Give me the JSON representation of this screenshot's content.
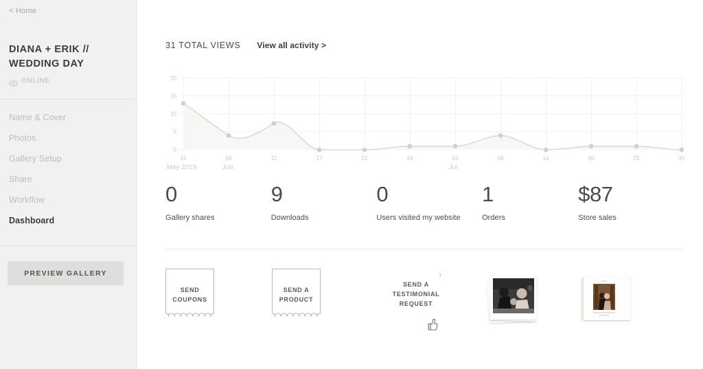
{
  "sidebar": {
    "home_link": "< Home",
    "gallery_title": "DIANA + ERIK // WEDDING DAY",
    "status": "ONLINE",
    "status_icon": "eye-icon",
    "nav_items": [
      {
        "label": "Name & Cover",
        "active": false
      },
      {
        "label": "Photos",
        "active": false
      },
      {
        "label": "Gallery Setup",
        "active": false
      },
      {
        "label": "Share",
        "active": false
      },
      {
        "label": "Workflow",
        "active": false
      },
      {
        "label": "Dashboard",
        "active": true
      }
    ],
    "preview_button": "PREVIEW GALLERY"
  },
  "header": {
    "total_views": "31 TOTAL VIEWS",
    "view_all_activity": "View all activity >"
  },
  "chart_data": {
    "type": "area",
    "title": "",
    "xlabel": "",
    "ylabel": "",
    "ylim": [
      0,
      20
    ],
    "yticks": [
      0,
      5,
      10,
      15,
      20
    ],
    "ytick_labels": [
      "0",
      "5",
      "10",
      "15",
      "20"
    ],
    "grid": true,
    "legend": "none",
    "categories": [
      "31",
      "06",
      "11",
      "17",
      "22",
      "28",
      "03",
      "09",
      "14",
      "20",
      "25",
      "31"
    ],
    "month_labels": [
      {
        "text": "May 2019",
        "at_category": "31"
      },
      {
        "text": "Jun",
        "at_category": "06"
      },
      {
        "text": "Jul",
        "at_category": "03"
      }
    ],
    "values": [
      13,
      4,
      7,
      0,
      0,
      1,
      1,
      4,
      0,
      1,
      1,
      0
    ],
    "series": [
      {
        "name": "Views",
        "values": [
          13,
          4,
          7,
          0,
          0,
          1,
          1,
          4,
          0,
          1,
          1,
          0
        ]
      }
    ],
    "line_color": "#d8d8d6",
    "fill_color": "#f7f7f6",
    "point_color": "#cfcfcd"
  },
  "stats": [
    {
      "value": "0",
      "label": "Gallery shares"
    },
    {
      "value": "9",
      "label": "Downloads"
    },
    {
      "value": "0",
      "label": "Users visited my website"
    },
    {
      "value": "1",
      "label": "Orders"
    },
    {
      "value": "$87",
      "label": "Store sales"
    }
  ],
  "cards": {
    "next_arrow": "›",
    "items": [
      {
        "type": "ticket",
        "label": "SEND\nCOUPONS",
        "name": "send-coupons-card"
      },
      {
        "type": "ticket",
        "label": "SEND A\nPRODUCT",
        "name": "send-product-card"
      },
      {
        "type": "testimonial",
        "label": "SEND A\nTESTIMONIAL\nREQUEST",
        "icon": "thumbs-up-icon",
        "name": "send-testimonial-card"
      },
      {
        "type": "photo-stack",
        "label": "",
        "name": "photo-prints-card"
      },
      {
        "type": "album",
        "label": "",
        "name": "photo-album-card"
      }
    ],
    "coupons_line1": "SEND",
    "coupons_line2": "COUPONS",
    "product_line1": "SEND A",
    "product_line2": "PRODUCT",
    "testimonial_line1": "SEND A",
    "testimonial_line2": "TESTIMONIAL",
    "testimonial_line3": "REQUEST"
  },
  "colors": {
    "sidebar_bg": "#f1f1f0",
    "text_dark": "#3c3c3c",
    "text_muted": "#bdbdbb",
    "button_bg": "#dededc"
  }
}
